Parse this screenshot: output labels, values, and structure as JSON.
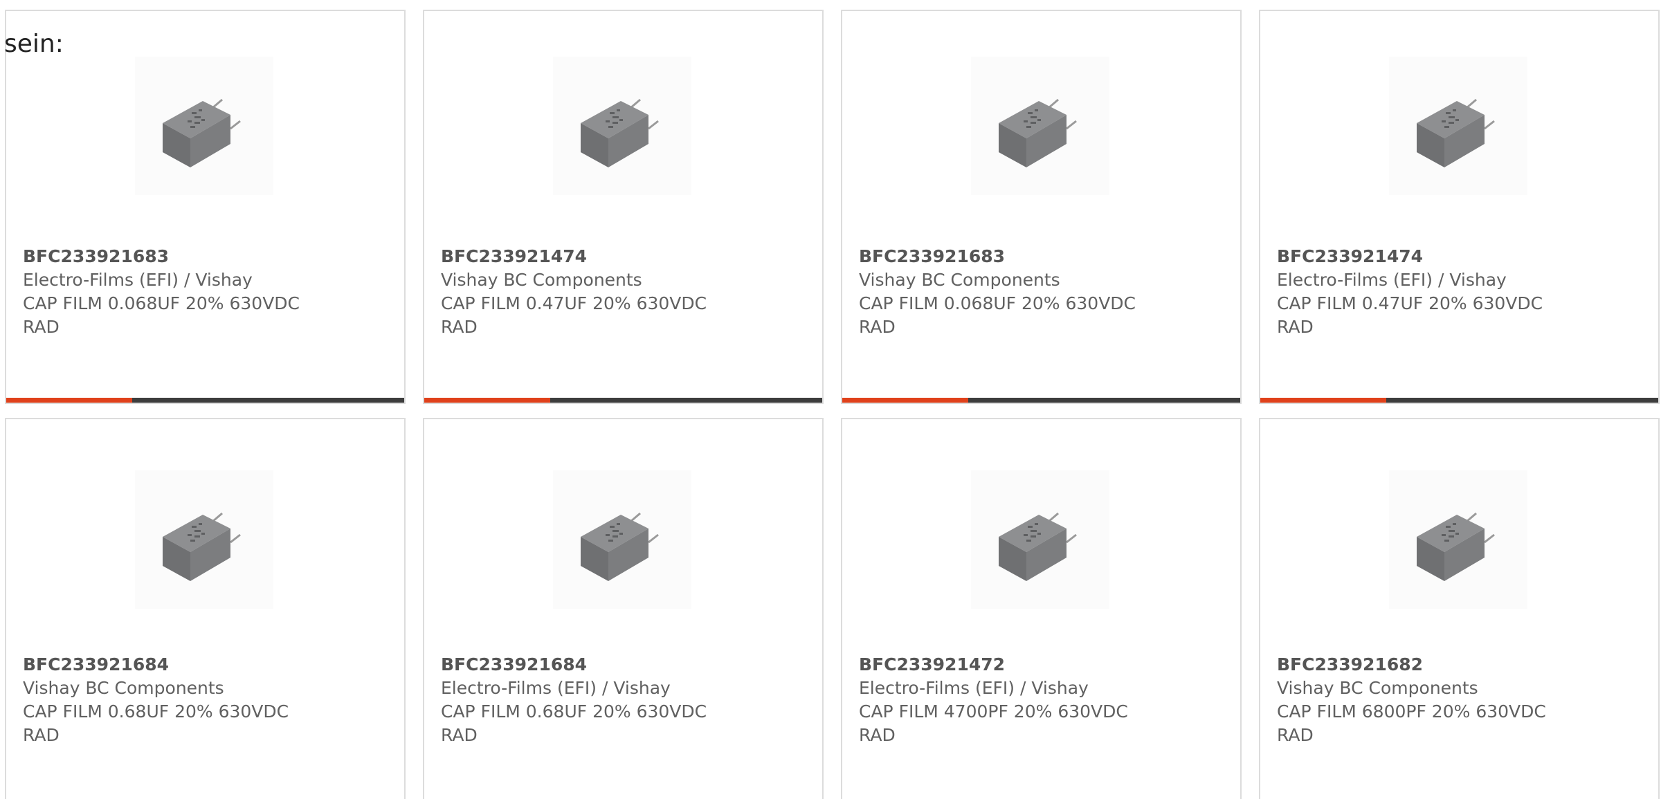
{
  "intro_text": "sein:",
  "colors": {
    "accent": "#e0411b",
    "bar_track": "#3d3d3d",
    "card_border": "#dcdcdc",
    "text": "#606060"
  },
  "products": [
    {
      "part_number": "BFC233921683",
      "manufacturer": "Electro-Films (EFI) / Vishay",
      "description": "CAP FILM 0.068UF 20% 630VDC",
      "package": "RAD",
      "image_icon": "film-capacitor-icon"
    },
    {
      "part_number": "BFC233921474",
      "manufacturer": "Vishay BC Components",
      "description": "CAP FILM 0.47UF 20% 630VDC",
      "package": "RAD",
      "image_icon": "film-capacitor-icon"
    },
    {
      "part_number": "BFC233921683",
      "manufacturer": "Vishay BC Components",
      "description": "CAP FILM 0.068UF 20% 630VDC",
      "package": "RAD",
      "image_icon": "film-capacitor-icon"
    },
    {
      "part_number": "BFC233921474",
      "manufacturer": "Electro-Films (EFI) / Vishay",
      "description": "CAP FILM 0.47UF 20% 630VDC",
      "package": "RAD",
      "image_icon": "film-capacitor-icon"
    },
    {
      "part_number": "BFC233921684",
      "manufacturer": "Vishay BC Components",
      "description": "CAP FILM 0.68UF 20% 630VDC",
      "package": "RAD",
      "image_icon": "film-capacitor-icon"
    },
    {
      "part_number": "BFC233921684",
      "manufacturer": "Electro-Films (EFI) / Vishay",
      "description": "CAP FILM 0.68UF 20% 630VDC",
      "package": "RAD",
      "image_icon": "film-capacitor-icon"
    },
    {
      "part_number": "BFC233921472",
      "manufacturer": "Electro-Films (EFI) / Vishay",
      "description": "CAP FILM 4700PF 20% 630VDC",
      "package": "RAD",
      "image_icon": "film-capacitor-icon"
    },
    {
      "part_number": "BFC233921682",
      "manufacturer": "Vishay BC Components",
      "description": "CAP FILM 6800PF 20% 630VDC",
      "package": "RAD",
      "image_icon": "film-capacitor-icon"
    }
  ]
}
